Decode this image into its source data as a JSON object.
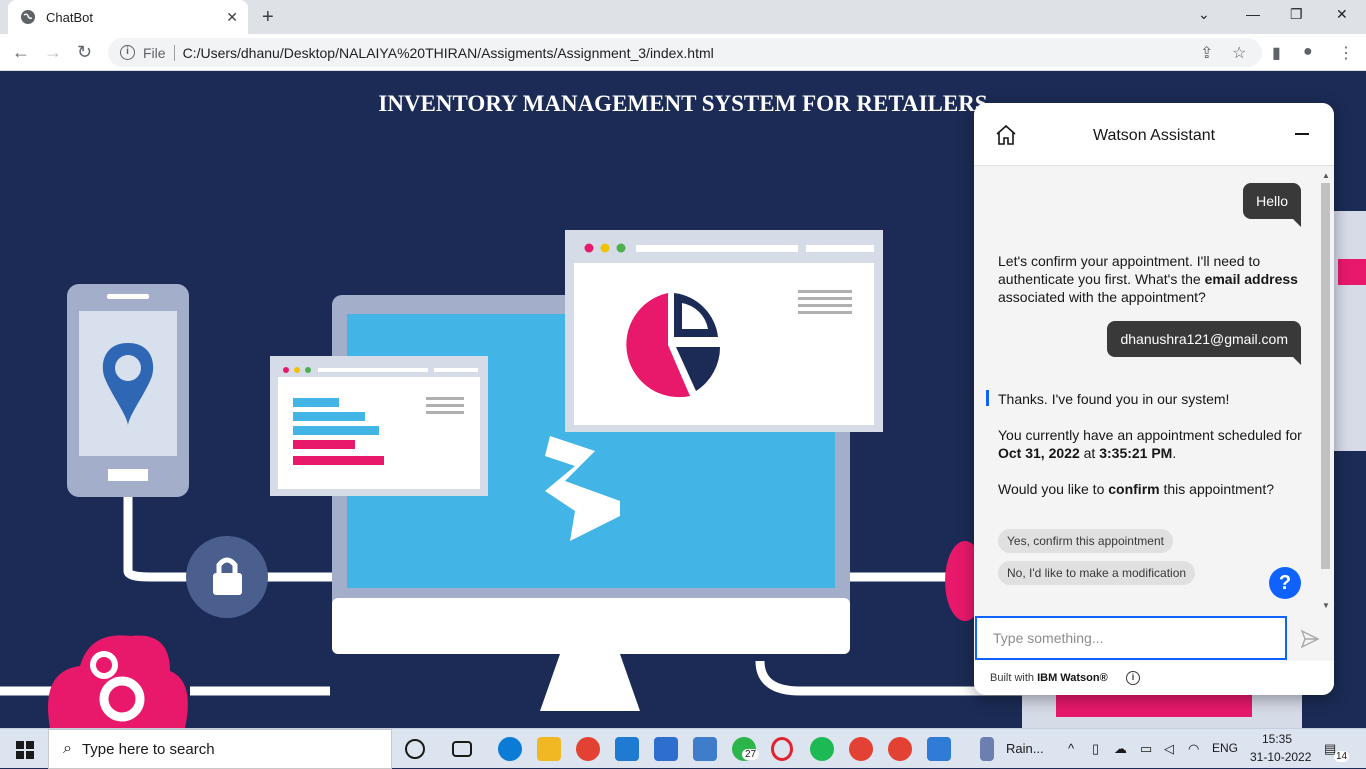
{
  "browser": {
    "tab_title": "ChatBot",
    "url_scheme": "File",
    "url": "C:/Users/dhanu/Desktop/NALAIYA%20THIRAN/Assigments/Assignment_3/index.html"
  },
  "page": {
    "title": "INVENTORY MANAGEMENT SYSTEM FOR RETAILERS"
  },
  "watson": {
    "title": "Watson Assistant",
    "messages": {
      "user_hello": "Hello",
      "bot_1_a": "Let's confirm your appointment. I'll need to authenticate you first. What's the ",
      "bot_1_b": "email address",
      "bot_1_c": " associated with the appointment?",
      "user_email": "dhanushra121@gmail.com",
      "bot_2": "Thanks. I've found you in our system!",
      "bot_3_a": "You currently have an appointment scheduled for ",
      "bot_3_date": "Oct 31, 2022",
      "bot_3_at": " at ",
      "bot_3_time": "3:35:21 PM",
      "bot_3_end": ".",
      "bot_4_a": "Would you like to ",
      "bot_4_b": "confirm",
      "bot_4_c": " this appointment?"
    },
    "options": {
      "yes": "Yes, confirm this appointment",
      "no": "No, I'd like to make a modification"
    },
    "help_label": "?",
    "input_placeholder": "Type something...",
    "footer_prefix": "Built with ",
    "footer_brand": "IBM Watson®"
  },
  "taskbar": {
    "search_placeholder": "Type here to search",
    "whatsapp_badge": "27",
    "running_app_label": "Rain...",
    "language": "ENG",
    "time": "15:35",
    "date": "31-10-2022",
    "notification_count": "14"
  },
  "colors": {
    "page_bg": "#1b2b55",
    "accent_pink": "#e8186b",
    "accent_blue": "#42b4e6",
    "watson_blue": "#0f62fe"
  }
}
